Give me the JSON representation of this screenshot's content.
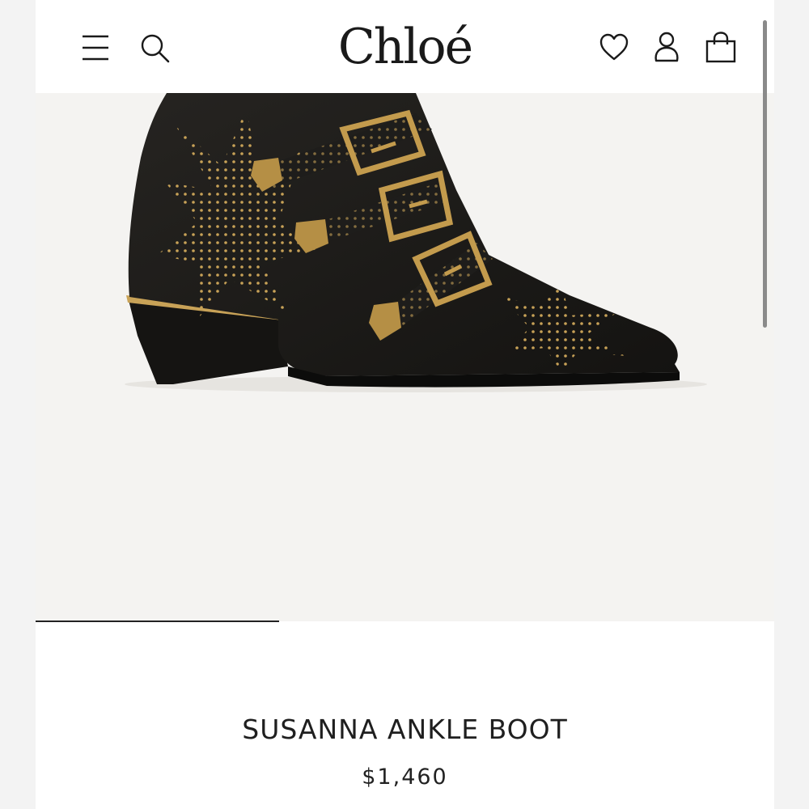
{
  "header": {
    "brand": "Chloé",
    "icons": {
      "menu": "menu-icon",
      "search": "search-icon",
      "wishlist": "heart-icon",
      "account": "user-icon",
      "cart": "shopping-bag-icon"
    }
  },
  "product": {
    "name": "SUSANNA ANKLE BOOT",
    "price": "$1,460",
    "image": "black-leather-studded-ankle-boot"
  },
  "gallery": {
    "current_slide": 1,
    "progress": 0.33
  },
  "colors": {
    "text": "#1a1a1a",
    "hero_background": "#f4f3f1",
    "boot_leather": "#1b1a18",
    "hardware_gold": "#c8a257"
  }
}
